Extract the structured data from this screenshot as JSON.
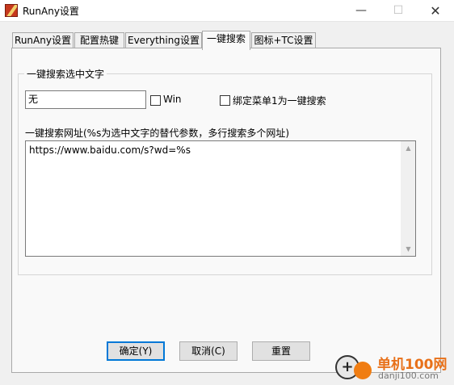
{
  "window": {
    "title": "RunAny设置",
    "minimize_label": "—",
    "maximize_label": "☐",
    "close_label": "✕"
  },
  "tabs": [
    {
      "label": "RunAny设置",
      "active": false
    },
    {
      "label": "配置热键",
      "active": false
    },
    {
      "label": "Everything设置",
      "active": false
    },
    {
      "label": "一键搜索",
      "active": true
    },
    {
      "label": "图标+TC设置",
      "active": false
    }
  ],
  "search_group": {
    "title": "一键搜索选中文字",
    "hotkey_value": "无",
    "win_checkbox": {
      "label": "Win",
      "checked": false
    },
    "bind_menu_checkbox": {
      "label": "绑定菜单1为一键搜索",
      "checked": false
    },
    "url_label": "一键搜索网址(%s为选中文字的替代参数，多行搜索多个网址)",
    "url_value": "https://www.baidu.com/s?wd=%s"
  },
  "buttons": {
    "ok": "确定(Y)",
    "cancel": "取消(C)",
    "reset": "重置"
  },
  "watermark": {
    "name": "单机100网",
    "url": "danji100.com"
  }
}
